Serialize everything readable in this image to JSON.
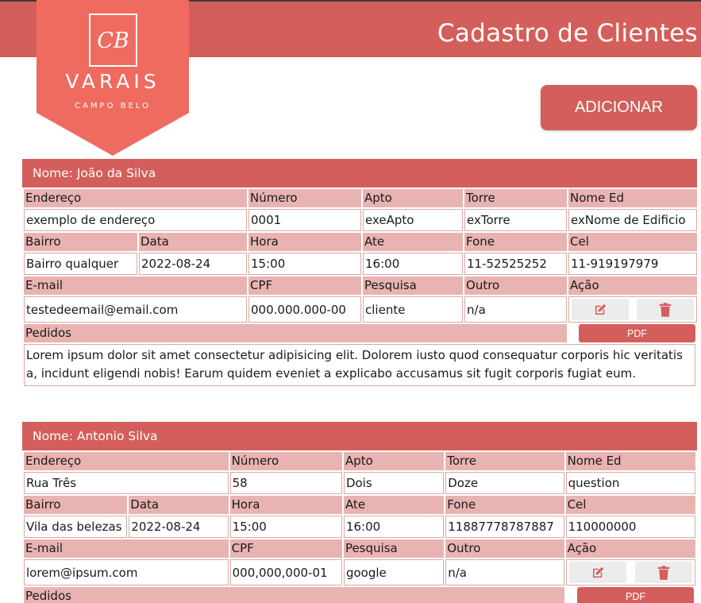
{
  "header": {
    "title": "Cadastro de Clientes",
    "logo": {
      "monogram": "CB",
      "name": "VARAIS",
      "subtitle": "CAMPO BELO"
    }
  },
  "actions": {
    "add_label": "ADICIONAR"
  },
  "colors": {
    "accent": "#d45e5b",
    "label_bg": "#e8b3b1",
    "logo_bg": "#ef6a5f"
  },
  "labels": {
    "endereco": "Endereço",
    "numero": "Número",
    "apto": "Apto",
    "torre": "Torre",
    "nome_ed": "Nome Ed",
    "bairro": "Bairro",
    "data": "Data",
    "hora": "Hora",
    "ate": "Ate",
    "fone": "Fone",
    "cel": "Cel",
    "email": "E-mail",
    "cpf": "CPF",
    "pesquisa": "Pesquisa",
    "outro": "Outro",
    "acao": "Ação",
    "pedidos": "Pedidos",
    "pdf": "PDF"
  },
  "clients": [
    {
      "name_label": "Nome: João da Silva",
      "endereco": "exemplo de endereço",
      "numero": "0001",
      "apto": "exeApto",
      "torre": "exTorre",
      "nome_ed": "exNome de Edificio",
      "bairro": "Bairro qualquer",
      "data": "2022-08-24",
      "hora": "15:00",
      "ate": "16:00",
      "fone": "11-52525252",
      "cel": "11-919197979",
      "email": "testedeemail@email.com",
      "cpf": "000.000.000-00",
      "pesquisa": "cliente",
      "outro": "n/a",
      "pedidos": "Lorem ipsum dolor sit amet consectetur adipisicing elit. Dolorem iusto quod consequatur corporis hic veritatis a, incidunt eligendi nobis! Earum quidem eveniet a explicabo accusamus sit fugit corporis fugiat eum."
    },
    {
      "name_label": "Nome: Antonio Silva",
      "endereco": "Rua Três",
      "numero": "58",
      "apto": "Dois",
      "torre": "Doze",
      "nome_ed": "question",
      "bairro": "Vila das belezas",
      "data": "2022-08-24",
      "hora": "15:00",
      "ate": "16:00",
      "fone": "11887778787887",
      "cel": "110000000",
      "email": "lorem@ipsum.com",
      "cpf": "000,000,000-01",
      "pesquisa": "google",
      "outro": "n/a",
      "pedidos": ""
    }
  ]
}
